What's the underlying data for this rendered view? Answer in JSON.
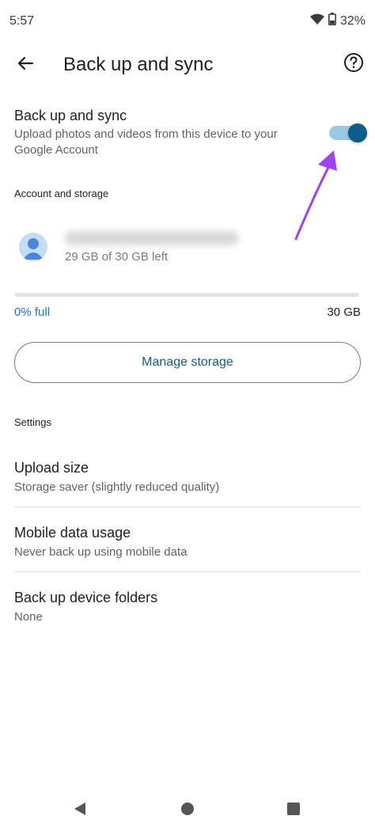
{
  "status_bar": {
    "time": "5:57",
    "battery": "32%",
    "icons": [
      "wifi-icon",
      "battery-icon"
    ]
  },
  "app_bar": {
    "title": "Back up and sync",
    "back_icon": "arrow-back-icon",
    "help_icon": "help-circle-icon"
  },
  "backup_sync": {
    "title": "Back up and sync",
    "description": "Upload photos and videos from this device to your Google Account",
    "enabled": true
  },
  "account_storage": {
    "header": "Account and storage",
    "storage_left": "29 GB of 30 GB left",
    "used_fraction": 0.0,
    "percent_full_label": "0% full",
    "total_label": "30 GB"
  },
  "manage_storage": {
    "label": "Manage storage"
  },
  "settings": {
    "header": "Settings",
    "items": [
      {
        "title": "Upload size",
        "subtitle": "Storage saver (slightly reduced quality)"
      },
      {
        "title": "Mobile data usage",
        "subtitle": "Never back up using mobile data"
      },
      {
        "title": "Back up device folders",
        "subtitle": "None"
      }
    ]
  },
  "nav_bar": {
    "icons": [
      "back-triangle-icon",
      "home-circle-icon",
      "recents-square-icon"
    ]
  },
  "colors": {
    "accent": "#0b5e8a",
    "toggle_track": "#9cc8e4",
    "progress_link": "#1a73e8",
    "annotation": "#a142f4"
  }
}
